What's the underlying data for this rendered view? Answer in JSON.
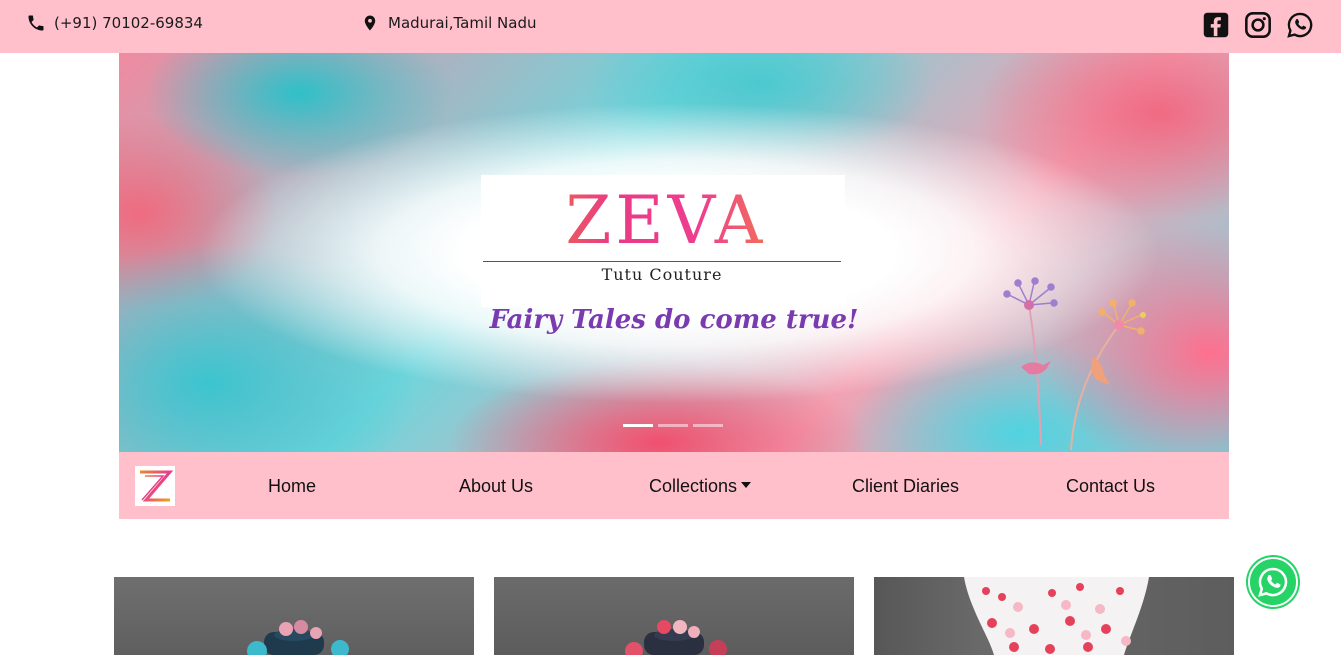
{
  "topbar": {
    "phone": "(+91) 70102-69834",
    "location": "Madurai,Tamil Nadu",
    "social": [
      "facebook-icon",
      "instagram-icon",
      "whatsapp-icon"
    ]
  },
  "hero": {
    "brand": "ZEVA",
    "subtitle": "Tutu Couture",
    "tagline": "Fairy Tales do come true!",
    "slides": 3,
    "active_slide": 1
  },
  "nav": {
    "logo_letter": "Z",
    "items": [
      "Home",
      "About Us",
      "Collections",
      "Client Diaries",
      "Contact Us"
    ]
  },
  "colors": {
    "topbar_bg": "#ffc0cb",
    "nav_bg": "#ffc0cb",
    "tagline": "#7a3bb0",
    "whatsapp": "#25d366"
  }
}
